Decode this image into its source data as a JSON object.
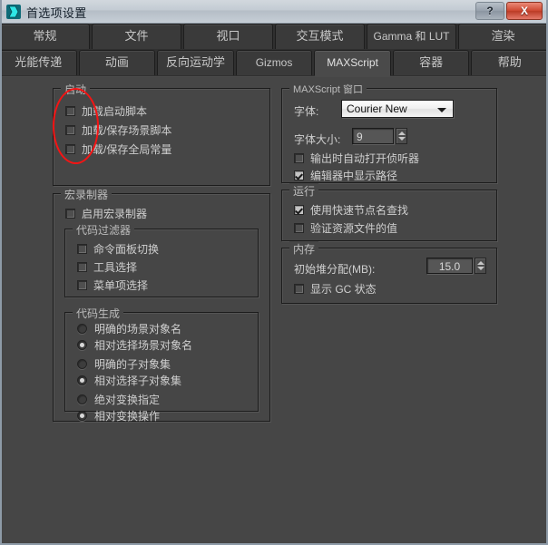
{
  "window": {
    "title": "首选项设置",
    "icon": "maxscript-app-icon",
    "help_button": "?",
    "close_button": "X"
  },
  "tabs": {
    "row1": [
      {
        "label": "常规",
        "active": false,
        "latin": false
      },
      {
        "label": "文件",
        "active": false,
        "latin": false
      },
      {
        "label": "视口",
        "active": false,
        "latin": false
      },
      {
        "label": "交互模式",
        "active": false,
        "latin": false
      },
      {
        "label": "Gamma 和 LUT",
        "active": false,
        "latin": true
      },
      {
        "label": "渲染",
        "active": false,
        "latin": false
      }
    ],
    "row2": [
      {
        "label": "光能传递",
        "active": false,
        "latin": false
      },
      {
        "label": "动画",
        "active": false,
        "latin": false
      },
      {
        "label": "反向运动学",
        "active": false,
        "latin": false
      },
      {
        "label": "Gizmos",
        "active": false,
        "latin": true
      },
      {
        "label": "MAXScript",
        "active": true,
        "latin": true
      },
      {
        "label": "容器",
        "active": false,
        "latin": false
      },
      {
        "label": "帮助",
        "active": false,
        "latin": false
      }
    ]
  },
  "startup": {
    "title": "启动",
    "options": [
      {
        "label": "加载启动脚本",
        "checked": false
      },
      {
        "label": "加载/保存场景脚本",
        "checked": false
      },
      {
        "label": "加载/保存全局常量",
        "checked": false
      }
    ]
  },
  "macro_recorder": {
    "title": "宏录制器",
    "enable": {
      "label": "启用宏录制器",
      "checked": false
    },
    "code_filter": {
      "title": "代码过滤器",
      "options": [
        {
          "label": "命令面板切换",
          "checked": false
        },
        {
          "label": "工具选择",
          "checked": false
        },
        {
          "label": "菜单项选择",
          "checked": false
        }
      ]
    },
    "code_generation": {
      "title": "代码生成",
      "groups": [
        [
          {
            "label": "明确的场景对象名",
            "selected": false
          },
          {
            "label": "相对选择场景对象名",
            "selected": true
          }
        ],
        [
          {
            "label": "明确的子对象集",
            "selected": false
          },
          {
            "label": "相对选择子对象集",
            "selected": true
          }
        ],
        [
          {
            "label": "绝对变换指定",
            "selected": false
          },
          {
            "label": "相对变换操作",
            "selected": true
          }
        ]
      ]
    }
  },
  "maxscript_window": {
    "title": "MAXScript 窗口",
    "font_label": "字体:",
    "font_value": "Courier New",
    "font_size_label": "字体大小:",
    "font_size_value": "9",
    "options": [
      {
        "label": "输出时自动打开侦听器",
        "checked": false
      },
      {
        "label": "编辑器中显示路径",
        "checked": true
      }
    ]
  },
  "run": {
    "title": "运行",
    "options": [
      {
        "label": "使用快速节点名查找",
        "checked": true
      },
      {
        "label": "验证资源文件的值",
        "checked": false
      }
    ]
  },
  "memory": {
    "title": "内存",
    "heap_label": "初始堆分配(MB):",
    "heap_value": "15.0",
    "gc_option": {
      "label": "显示 GC 状态",
      "checked": false
    }
  },
  "annotation": {
    "shape": "red-ellipse",
    "color": "#f41414"
  }
}
